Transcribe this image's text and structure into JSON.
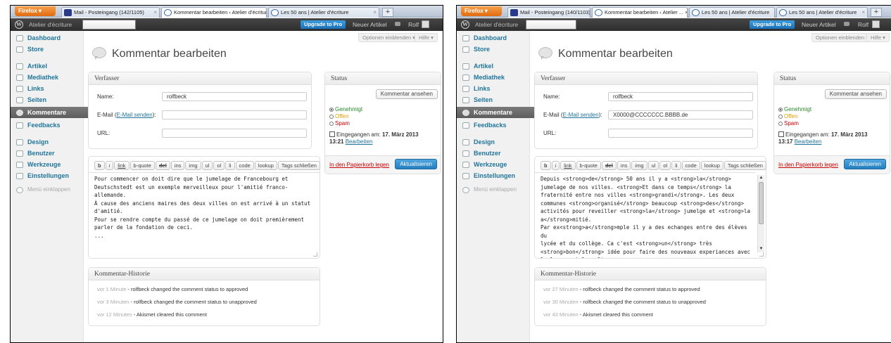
{
  "panels": [
    {
      "browser": {
        "firefox_label": "Firefox ▾",
        "tabs": [
          {
            "title": "Mail - Posteingang (142/1105)"
          },
          {
            "title": "Kommentar bearbeiten ‹ Atelier d'écriture ... ×"
          },
          {
            "title": "Les 50 ans | Atelier d'écriture"
          }
        ],
        "newtab": "+"
      },
      "adminbar": {
        "site": "Atelier d'écriture",
        "upgrade": "Upgrade to Pro",
        "new_item": "Neuer Artikel",
        "user": "Rolf"
      },
      "screen_options": "Optionen einblenden ▾",
      "help": "Hilfe ▾",
      "menu": [
        "Dashboard",
        "Store",
        "Artikel",
        "Mediathek",
        "Links",
        "Seiten",
        "Kommentare",
        "Feedbacks",
        "Design",
        "Benutzer",
        "Werkzeuge",
        "Einstellungen",
        "Menü einklappen"
      ],
      "page_title": "Kommentar bearbeiten",
      "author": {
        "heading": "Verfasser",
        "name_label": "Name:",
        "name_value": "rolfbeck",
        "email_label": "E-Mail (",
        "email_link": "E-Mail senden",
        "email_tail": "):",
        "email_value": "",
        "url_label": "URL:",
        "url_value": ""
      },
      "quicktags": [
        "b",
        "i",
        "link",
        "b-quote",
        "del",
        "ins",
        "img",
        "ul",
        "ol",
        "li",
        "code",
        "lookup",
        "Tags schließen"
      ],
      "comment_text": "Pour commencer on doit dire que le jumelage de Francebourg et\nDeutschstedt est un exemple merveilleux pour l'amitié franco-allemande.\nÀ cause des anciens maires des deux villes on est arrivé à un statut\nd'amitié.\nPour se rendre compte du passé de ce jumelage on doit premièrement\nparler de la fondation de ceci.\n...",
      "history": {
        "heading": "Kommentar-Historie",
        "items": [
          {
            "time": "vor 1 Minute",
            "text": " - rolfbeck changed the comment status to approved"
          },
          {
            "time": "vor 3 Minuten",
            "text": " - rolfbeck changed the comment status to unapproved"
          },
          {
            "time": "vor 12 Minuten",
            "text": " - Akismet cleared this comment"
          }
        ]
      },
      "status": {
        "heading": "Status",
        "view_button": "Kommentar ansehen",
        "approved": "Genehmigt",
        "pending": "Offen",
        "spam": "Spam",
        "received_label": "Eingegangen am: ",
        "received_date": "17. März 2013",
        "received_time": "13:21",
        "edit_link": "Bearbeiten",
        "trash": "In den Papierkorb legen",
        "update": "Aktualisieren"
      }
    },
    {
      "browser": {
        "firefox_label": "Firefox ▾",
        "tabs": [
          {
            "title": "Mail - Posteingang (140/1103)"
          },
          {
            "title": "Kommentar bearbeiten ‹ Atelier ... ×"
          },
          {
            "title": "Les 50 ans | Atelier d'écriture"
          },
          {
            "title": "Les 50 ans | Atelier d'écriture"
          }
        ],
        "newtab": "+"
      },
      "adminbar": {
        "site": "Atelier d'écriture",
        "upgrade": "Upgrade to Pro",
        "new_item": "Neuer Artikel",
        "user": "Rolf"
      },
      "screen_options": "Optionen einblenden ▾",
      "help": "Hilfe ▾",
      "menu": [
        "Dashboard",
        "Store",
        "Artikel",
        "Mediathek",
        "Links",
        "Seiten",
        "Kommentare",
        "Feedbacks",
        "Design",
        "Benutzer",
        "Werkzeuge",
        "Einstellungen",
        "Menü einklappen"
      ],
      "page_title": "Kommentar bearbeiten",
      "author": {
        "heading": "Verfasser",
        "name_label": "Name:",
        "name_value": "rolfbeck",
        "email_label": "E-Mail (",
        "email_link": "E-Mail senden",
        "email_tail": "):",
        "email_value": "X0000@CCCCCCC.BBBB.de",
        "url_label": "URL:",
        "url_value": ""
      },
      "quicktags": [
        "b",
        "i",
        "link",
        "b-quote",
        "del",
        "ins",
        "img",
        "ul",
        "ol",
        "li",
        "code",
        "lookup",
        "Tags schließen"
      ],
      "comment_text": "Depuis <strong>de</strong> 50 ans il y a <strong>la</strong>\njumelage de nos villes. <strong>Et dans ce temps</strong> la\nfraternité entre nos villes <strong>grandi</strong>. Les deux\ncommunes <strong>organisé</strong> beaucoup <strong>des</strong>\nactivités pour reveiller <strong>la</strong> jumelge et <strong>la\na</strong>mitié.\nPar ex<strong>a</strong>mple il y a des echanges entre des élèves du\nlycée et du collège. Ca c'est <strong>un</strong> très\n<strong>bon</strong> idée pour faire des nouveaux experiances avec\nla langue et la culture.",
      "history": {
        "heading": "Kommentar-Historie",
        "items": [
          {
            "time": "vor 27 Minuten",
            "text": " - rolfbeck changed the comment status to approved"
          },
          {
            "time": "vor 30 Minuten",
            "text": " - rolfbeck changed the comment status to unapproved"
          },
          {
            "time": "vor 43 Minuten",
            "text": " - Akismet cleared this comment"
          }
        ]
      },
      "status": {
        "heading": "Status",
        "view_button": "Kommentar ansehen",
        "approved": "Genehmigt",
        "pending": "Offen",
        "spam": "Spam",
        "received_label": "Eingegangen am: ",
        "received_date": "17. März 2013",
        "received_time": "13:17",
        "edit_link": "Bearbeiten",
        "trash": "In den Papierkorb legen",
        "update": "Aktualisieren"
      }
    }
  ]
}
